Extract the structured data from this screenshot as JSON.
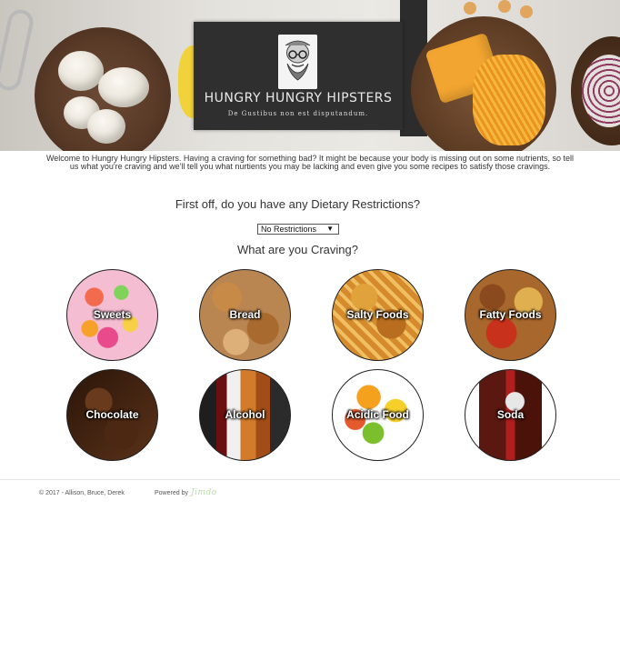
{
  "header": {
    "site_title": "HUNGRY HUNGRY HIPSTERS",
    "tagline": "De Gustibus non est disputandum."
  },
  "intro": {
    "text": "Welcome to Hungry Hungry Hipsters. Having a craving for something bad? It might be because your body is missing out on some nutrients, so tell us what you're craving and we'll tell you what nurtients you may be lacking and even give you some recipes to satisfy those cravings."
  },
  "dietary": {
    "question": "First off, do you have any Dietary Restrictions?",
    "selected": "No Restrictions"
  },
  "cravings": {
    "question": "What are you Craving?",
    "items": [
      {
        "label": "Sweets"
      },
      {
        "label": "Bread"
      },
      {
        "label": "Salty Foods"
      },
      {
        "label": "Fatty Foods"
      },
      {
        "label": "Chocolate"
      },
      {
        "label": "Alcohol"
      },
      {
        "label": "Acidic Food"
      },
      {
        "label": "Soda"
      }
    ]
  },
  "footer": {
    "copyright": "© 2017 - Allison, Bruce, Derek",
    "powered_by": "Powered by",
    "powered_logo": "Jimdo"
  }
}
